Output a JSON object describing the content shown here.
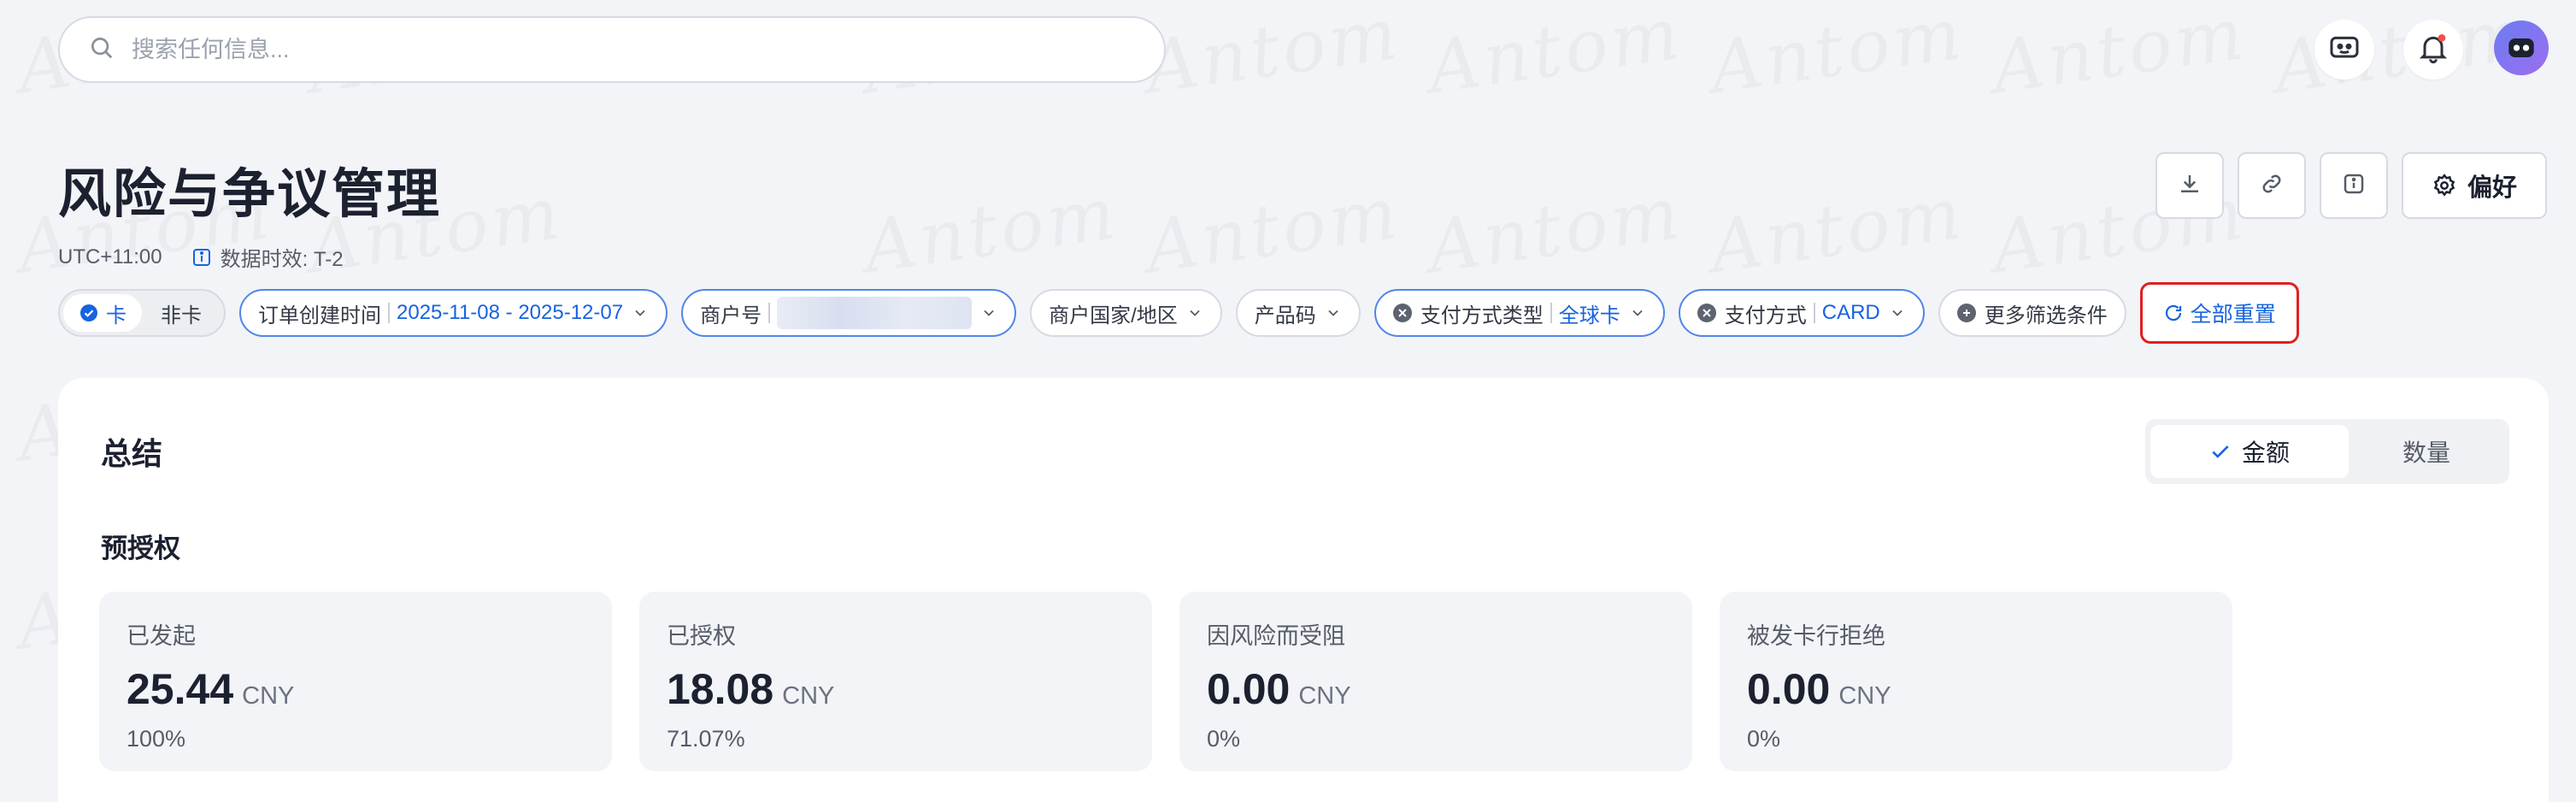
{
  "search": {
    "placeholder": "搜索任何信息..."
  },
  "header": {
    "title": "风险与争议管理",
    "timezone": "UTC+11:00",
    "data_latency": "数据时效: T-2",
    "pref_label": "偏好"
  },
  "filters": {
    "card_type": {
      "selected": "卡",
      "other": "非卡"
    },
    "order_time": {
      "label": "订单创建时间",
      "value": "2025-11-08 - 2025-12-07"
    },
    "merchant": {
      "label": "商户号"
    },
    "country": {
      "label": "商户国家/地区"
    },
    "product": {
      "label": "产品码"
    },
    "pay_type": {
      "label": "支付方式类型",
      "value": "全球卡"
    },
    "pay_method": {
      "label": "支付方式",
      "value": "CARD"
    },
    "more": {
      "label": "更多筛选条件"
    },
    "reset": {
      "label": "全部重置"
    }
  },
  "summary": {
    "title": "总结",
    "toggle": {
      "amount": "金额",
      "count": "数量"
    },
    "section_title": "预授权",
    "metrics": [
      {
        "label": "已发起",
        "value": "25.44",
        "currency": "CNY",
        "pct": "100%"
      },
      {
        "label": "已授权",
        "value": "18.08",
        "currency": "CNY",
        "pct": "71.07%"
      },
      {
        "label": "因风险而受阻",
        "value": "0.00",
        "currency": "CNY",
        "pct": "0%"
      },
      {
        "label": "被发卡行拒绝",
        "value": "0.00",
        "currency": "CNY",
        "pct": "0%"
      }
    ]
  },
  "icons": {
    "search": "search-icon",
    "chat": "chat-bot-icon",
    "bell": "bell-icon",
    "download": "download-icon",
    "link": "link-icon",
    "info": "info-icon",
    "gear": "gear-icon",
    "check": "check-icon",
    "refresh": "refresh-icon",
    "chevron": "chevron-down-icon",
    "clear": "clear-icon",
    "add": "add-icon"
  },
  "colors": {
    "accent": "#1763e0",
    "reset_border": "#e02020",
    "notify_dot": "#f0504a"
  }
}
